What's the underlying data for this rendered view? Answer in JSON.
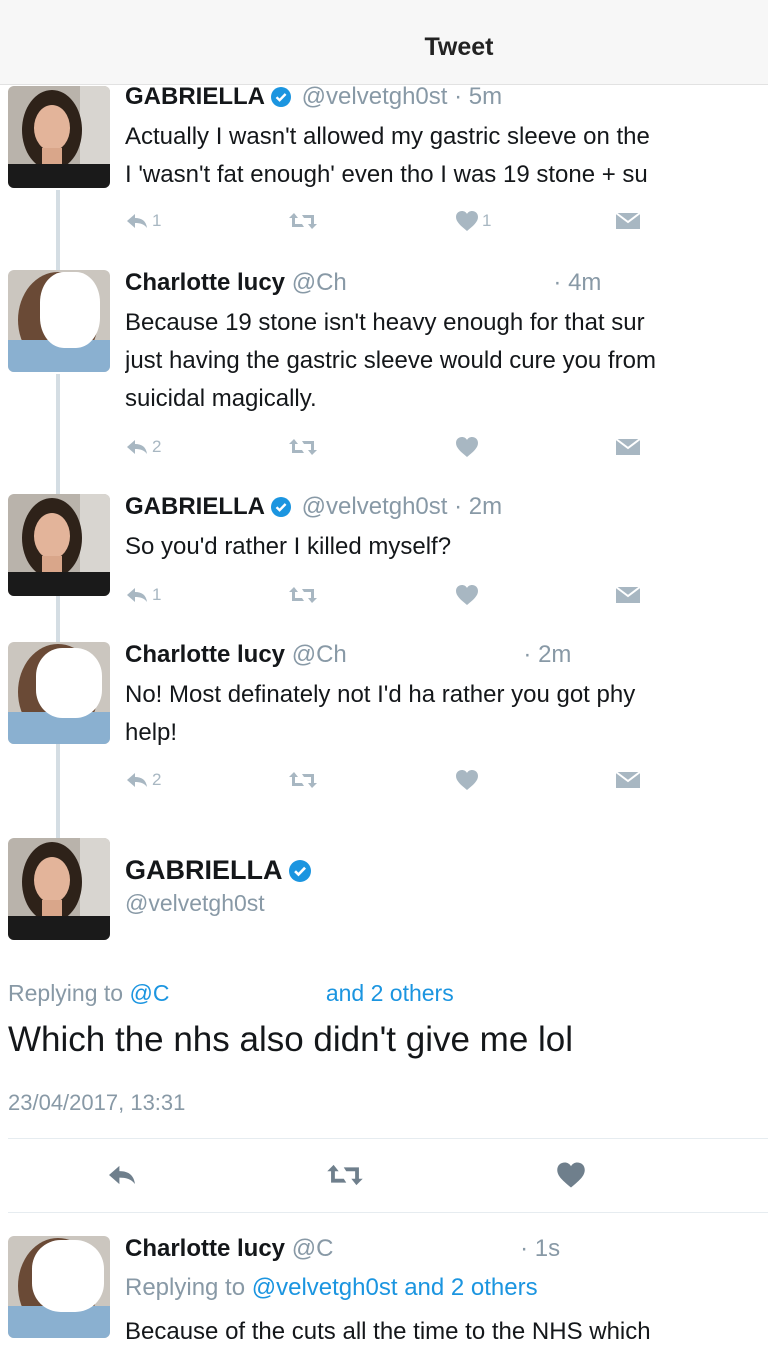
{
  "header": {
    "title": "Tweet"
  },
  "tweets": [
    {
      "name": "GABRIELLA",
      "handle": "@velvetgh0st",
      "time": "· 5m",
      "lines": [
        "Actually I wasn't allowed my gastric sleeve on the",
        "I 'wasn't fat enough' even tho I was 19 stone + su"
      ],
      "reply_count": "1",
      "like_count": "1"
    },
    {
      "name": "Charlotte lucy",
      "handle": "@Ch",
      "time": "· 4m",
      "lines": [
        "Because 19 stone isn't heavy enough for that sur",
        "just having the gastric sleeve would cure you from",
        "suicidal magically."
      ],
      "reply_count": "2",
      "like_count": ""
    },
    {
      "name": "GABRIELLA",
      "handle": "@velvetgh0st",
      "time": "· 2m",
      "lines": [
        "So you'd rather I killed myself?"
      ],
      "reply_count": "1",
      "like_count": ""
    },
    {
      "name": "Charlotte lucy",
      "handle": "@Ch",
      "time": "· 2m",
      "lines": [
        "No! Most definately not I'd ha rather you got phy",
        "help!"
      ],
      "reply_count": "2",
      "like_count": ""
    }
  ],
  "focus": {
    "name": "GABRIELLA",
    "handle": "@velvetgh0st",
    "replying_prefix": "Replying to",
    "replying_to": "@C",
    "replying_suffix": "and 2 others",
    "text": "Which the nhs also didn't give me lol",
    "timestamp": "23/04/2017, 13:31"
  },
  "bottom_tweet": {
    "name": "Charlotte lucy",
    "handle": "@C",
    "time": "· 1s",
    "replying_prefix": "Replying to",
    "replying_to": "@velvetgh0st and 2 others",
    "text": "Because of the cuts all the time to the NHS which"
  },
  "colors": {
    "accent": "#1b95e0",
    "meta": "#8899a6",
    "icon": "#a8b7c2",
    "thread_line": "#d4dde3"
  },
  "icons": [
    "reply-icon",
    "retweet-icon",
    "like-icon",
    "message-icon",
    "verified-icon"
  ]
}
